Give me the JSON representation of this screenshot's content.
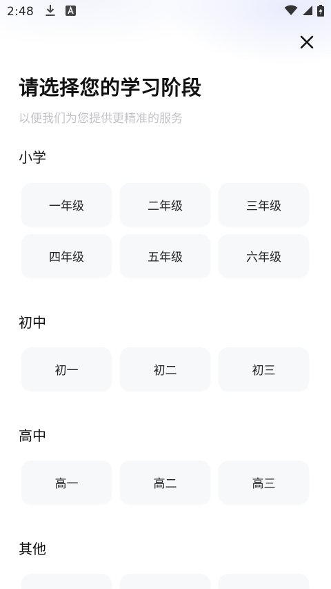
{
  "status_bar": {
    "time": "2:48",
    "icons": [
      "download-icon",
      "app-a-icon",
      "wifi-icon",
      "signal-icon",
      "battery-charging-icon"
    ]
  },
  "header": {
    "close_icon": "close-icon",
    "title": "请选择您的学习阶段",
    "subtitle": "以便我们为您提供更精准的服务"
  },
  "sections": [
    {
      "title": "小学",
      "grades": [
        "一年级",
        "二年级",
        "三年级",
        "四年级",
        "五年级",
        "六年级"
      ]
    },
    {
      "title": "初中",
      "grades": [
        "初一",
        "初二",
        "初三"
      ]
    },
    {
      "title": "高中",
      "grades": [
        "高一",
        "高二",
        "高三"
      ]
    },
    {
      "title": "其他",
      "grades": []
    }
  ],
  "colors": {
    "button_bg": "#f7f8fa",
    "subtitle": "#c4c4c8",
    "text": "#111111"
  }
}
